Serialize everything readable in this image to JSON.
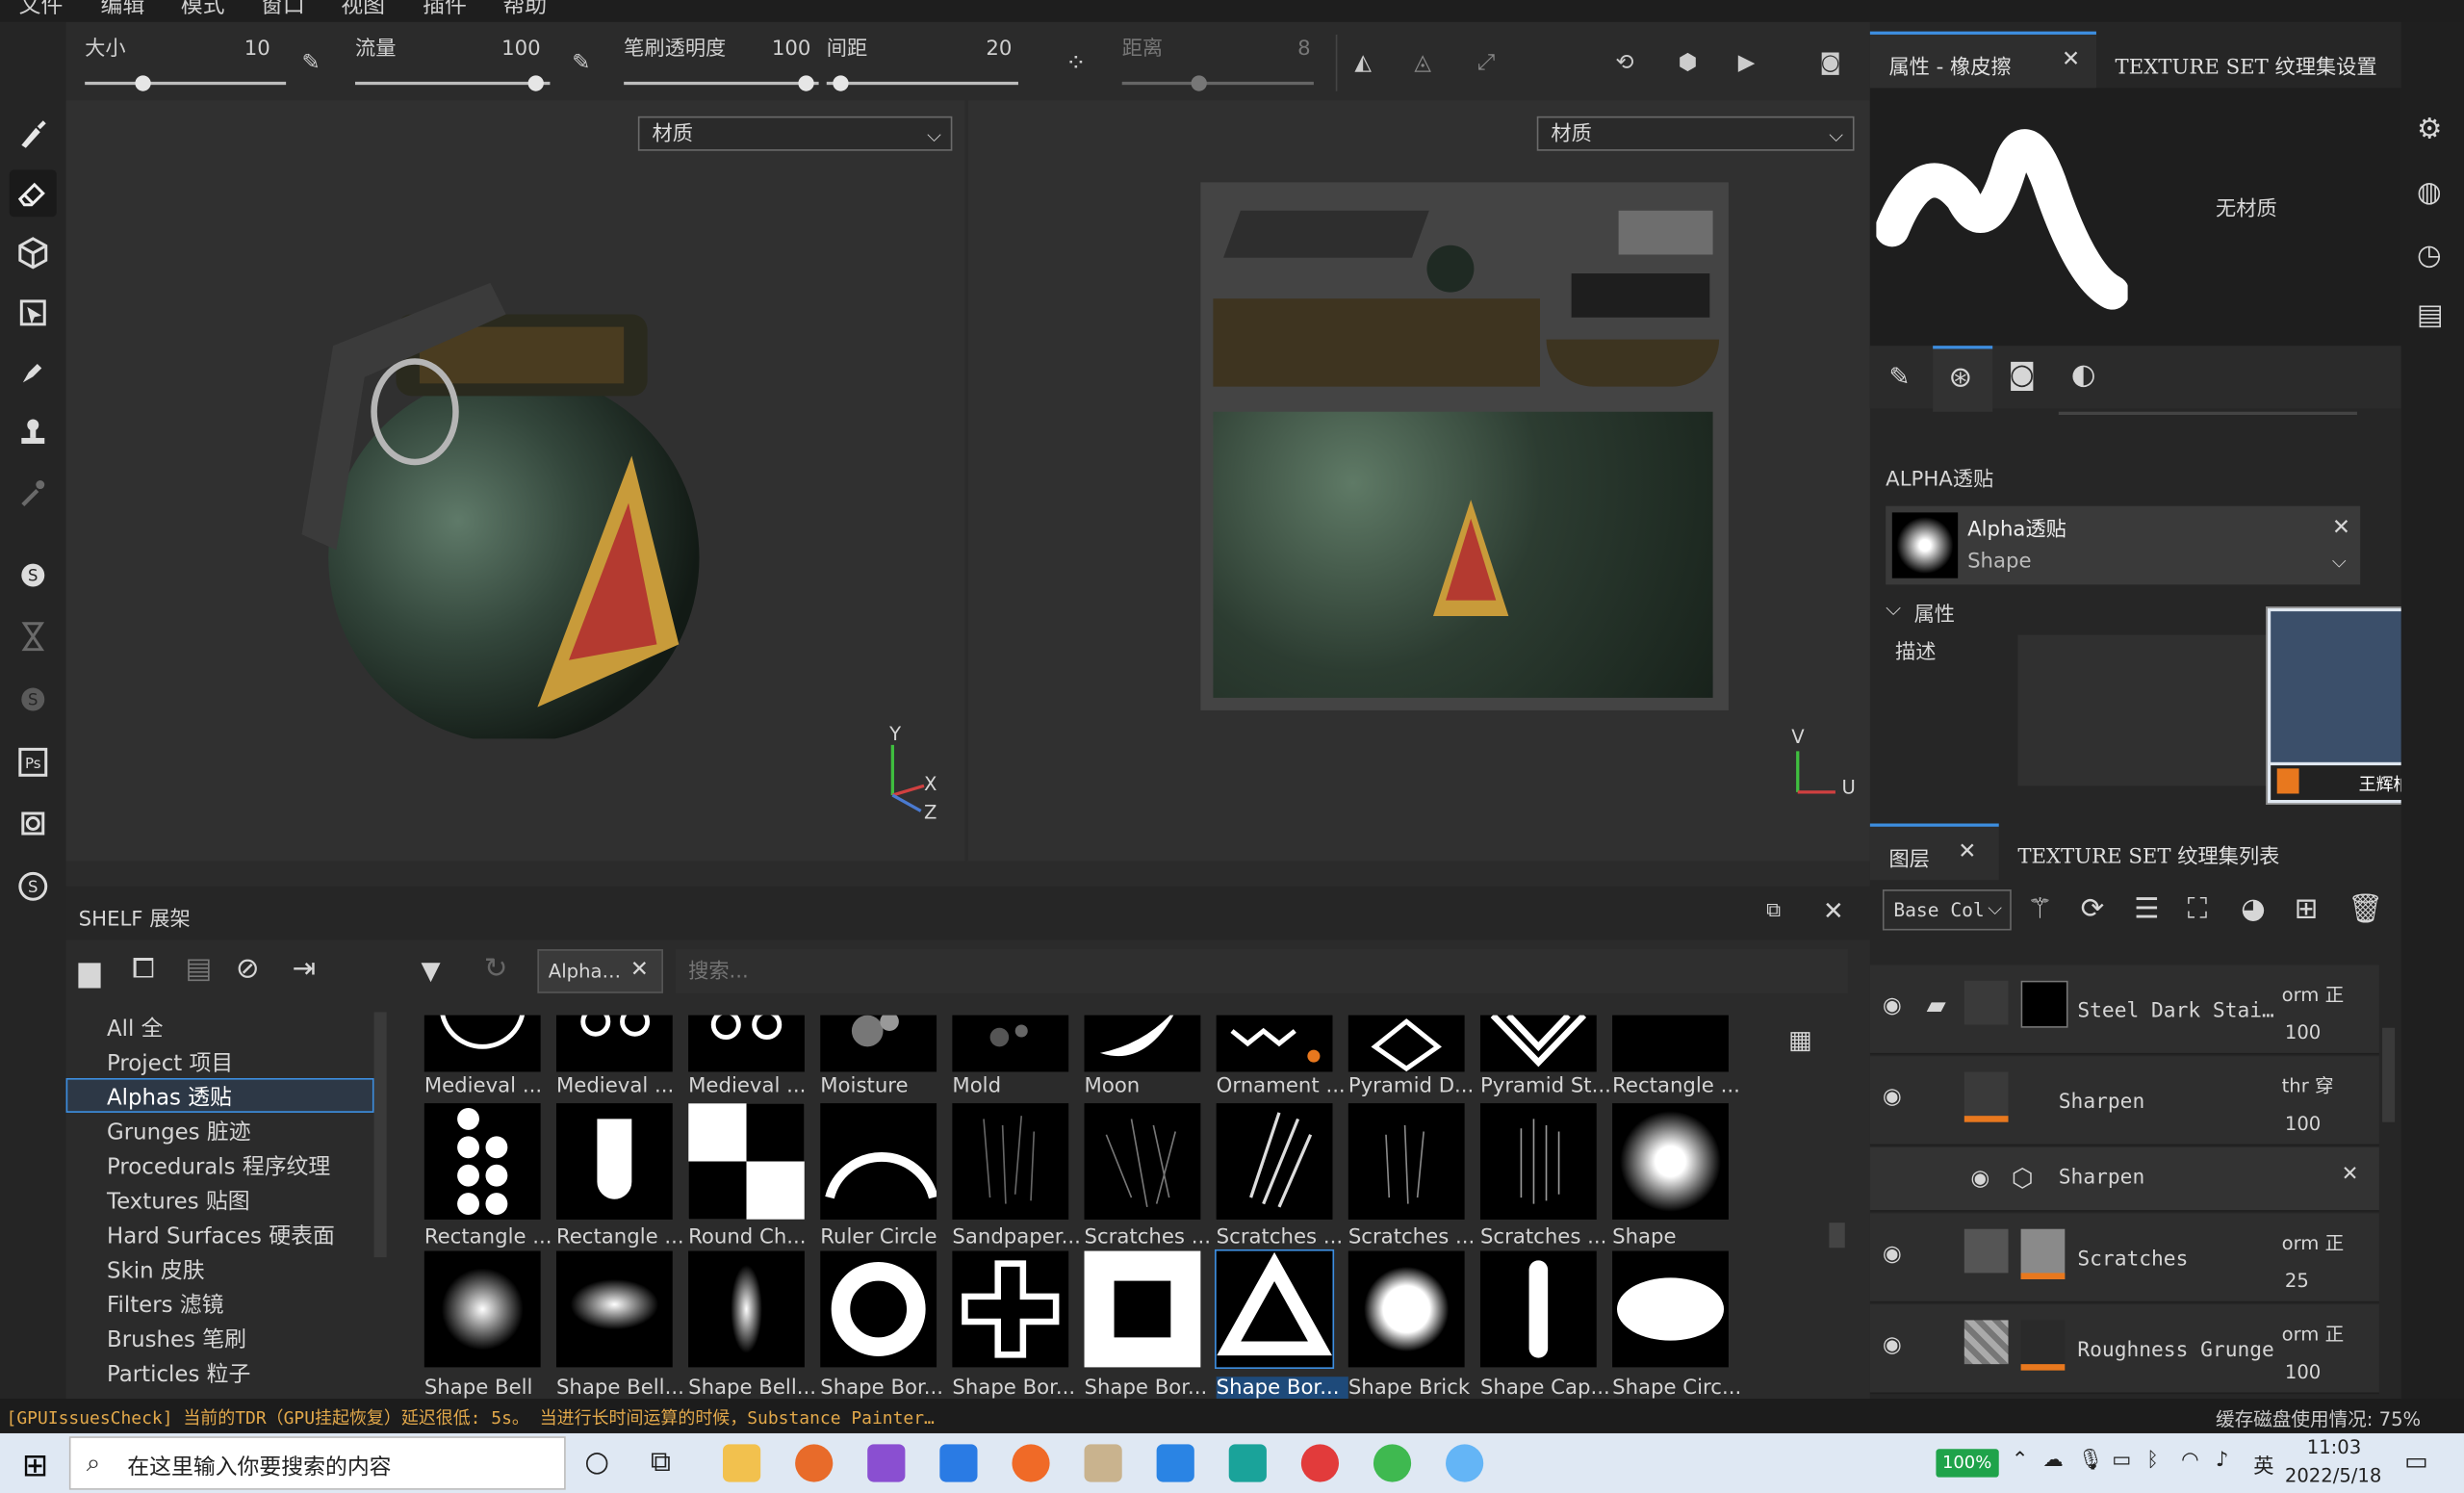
{
  "menu": [
    "文件",
    "编辑",
    "模式",
    "窗口",
    "视图",
    "插件",
    "帮助"
  ],
  "toolbar": {
    "size_label": "大小",
    "size_value": "10",
    "flow_label": "流量",
    "flow_value": "100",
    "opacity_label": "笔刷透明度",
    "opacity_value": "100",
    "spacing_label": "间距",
    "spacing_value": "20",
    "distance_label": "距离",
    "distance_value": "8"
  },
  "viewport": {
    "left_dropdown": "材质",
    "right_dropdown": "材质",
    "axis_y": "Y",
    "axis_x": "X",
    "axis_z": "Z",
    "uv_v": "V",
    "uv_u": "U"
  },
  "properties": {
    "tab_title": "属性 - 橡皮擦",
    "tab_texture_set": "TEXTURE SET 纹理集设置",
    "no_material": "无材质",
    "alpha_section": "ALPHA透贴",
    "alpha_name": "Alpha透贴",
    "alpha_value": "Shape",
    "attr_section": "属性",
    "desc_label": "描述",
    "share_text": "王辉柏的屏幕"
  },
  "layers": {
    "tab_title": "图层",
    "tab_texture_list": "TEXTURE SET 纹理集列表",
    "channel": "Base Col",
    "items": [
      {
        "name": "Steel Dark Stai…",
        "blend": "orm 正",
        "opacity": "100"
      },
      {
        "name": "Sharpen",
        "blend": "thr 穿",
        "opacity": "100"
      },
      {
        "name": "Sharpen",
        "blend": "",
        "opacity": ""
      },
      {
        "name": "Scratches",
        "blend": "orm 正",
        "opacity": "25"
      },
      {
        "name": "Roughness Grunge",
        "blend": "orm 正",
        "opacity": "100"
      }
    ]
  },
  "shelf": {
    "title": "SHELF 展架",
    "filter_tag": "Alpha…",
    "search_placeholder": "搜索...",
    "categories": [
      "All 全",
      "Project 项目",
      "Alphas 透贴",
      "Grunges 脏迹",
      "Procedurals 程序纹理",
      "Textures 贴图",
      "Hard Surfaces 硬表面",
      "Skin 皮肤",
      "Filters 滤镜",
      "Brushes 笔刷",
      "Particles 粒子"
    ],
    "selected_category": "Alphas 透贴",
    "row1": [
      "Medieval ...",
      "Medieval ...",
      "Medieval ...",
      "Moisture",
      "Mold",
      "Moon",
      "Ornament ...",
      "Pyramid D...",
      "Pyramid St...",
      "Rectangle ..."
    ],
    "row2": [
      "Rectangle ...",
      "Rectangle ...",
      "Round Ch...",
      "Ruler Circle",
      "Sandpaper...",
      "Scratches ...",
      "Scratches ...",
      "Scratches ...",
      "Scratches ...",
      "Shape"
    ],
    "row3": [
      "Shape Bell",
      "Shape Bell...",
      "Shape Bell...",
      "Shape Bor...",
      "Shape Bor...",
      "Shape Bor...",
      "Shape Bor...",
      "Shape Brick",
      "Shape Cap...",
      "Shape Circ..."
    ]
  },
  "status": {
    "message": "[GPUIssuesCheck] 当前的TDR（GPU挂起恢复）延迟很低: 5s。 当进行长时间运算的时候，Substance Painter…",
    "disk": "缓存磁盘使用情况: 75%"
  },
  "taskbar": {
    "search_placeholder": "在这里输入你要搜索的内容",
    "battery": "100%",
    "ime": "英",
    "time": "11:03",
    "date": "2022/5/18"
  },
  "colors": {
    "accent": "#3d8ee0",
    "orange": "#e8781e",
    "panel": "#262626",
    "taskbar": "#dfe8f3"
  }
}
